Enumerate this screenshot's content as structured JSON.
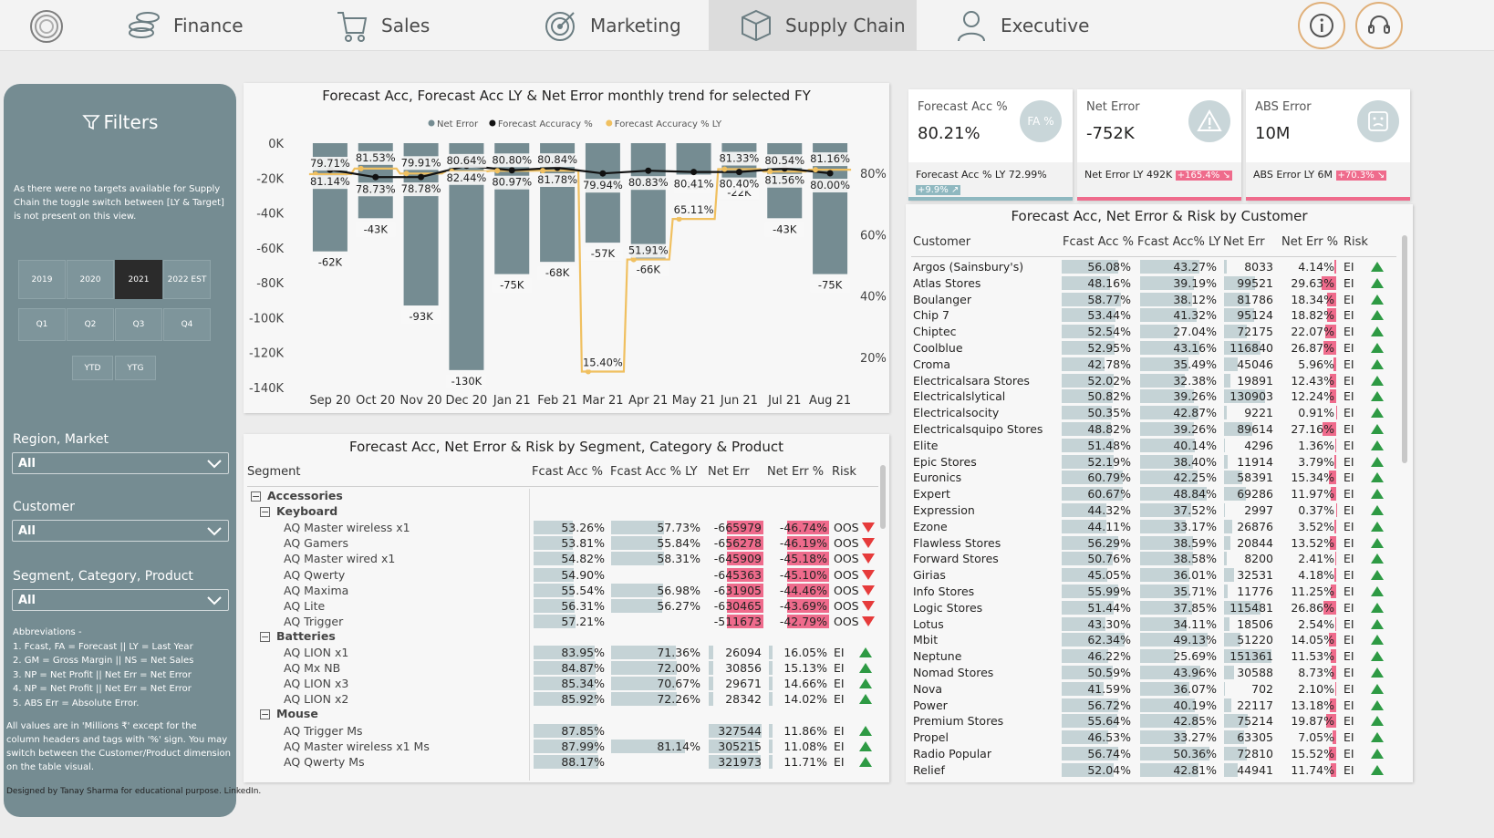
{
  "nav": {
    "tabs": [
      {
        "label": "Finance",
        "icon": "coins-icon"
      },
      {
        "label": "Sales",
        "icon": "cart-icon"
      },
      {
        "label": "Marketing",
        "icon": "target-icon"
      },
      {
        "label": "Supply Chain",
        "icon": "box-icon",
        "active": true
      },
      {
        "label": "Executive",
        "icon": "person-icon"
      }
    ],
    "info_icon": "info-icon",
    "support_icon": "headset-icon"
  },
  "filters": {
    "title": "Filters",
    "note": "As there were no targets available for Supply Chain the toggle switch between [LY & Target] is not present on this view.",
    "years": [
      "2019",
      "2020",
      "2021",
      "2022 EST"
    ],
    "selected_year": "2021",
    "quarters": [
      "Q1",
      "Q2",
      "Q3",
      "Q4"
    ],
    "periods": [
      "YTD",
      "YTG"
    ],
    "region_label": "Region, Market",
    "region_value": "All",
    "customer_label": "Customer",
    "customer_value": "All",
    "segment_label": "Segment, Category, Product",
    "segment_value": "All",
    "abbreviations": [
      "Abbreviations -",
      "1. Fcast, FA = Forecast || LY = Last Year",
      "2. GM = Gross Margin || NS = Net Sales",
      "3. NP = Net Profit || Net Err = Net Error",
      "4. NP = Net Profit || Net Err = Net Error",
      "5. ABS Err = Absolute Error."
    ],
    "values_note": "All values are in 'Millions ₹' except for the column headers and tags with '%' sign. You may switch between the Customer/Product dimension on the table visual."
  },
  "trend_chart": {
    "title": "Forecast Acc, Forecast Acc LY & Net Error monthly trend for selected FY",
    "legend": [
      {
        "label": "Net Error",
        "color": "#758c92"
      },
      {
        "label": "Forecast Accuracy %",
        "color": "#111111"
      },
      {
        "label": "Forecast Accuracy % LY",
        "color": "#f0c060"
      }
    ]
  },
  "chart_data": {
    "type": "bar",
    "categories": [
      "Sep 20",
      "Oct 20",
      "Nov 20",
      "Dec 20",
      "Jan 21",
      "Feb 21",
      "Mar 21",
      "Apr 21",
      "May 21",
      "Jun 21",
      "Jul 21",
      "Aug 21"
    ],
    "series": [
      {
        "name": "Net Error",
        "type": "bar",
        "axis": "left",
        "values": [
          -62,
          -43,
          -93,
          -130,
          -75,
          -68,
          -57,
          -66,
          -18,
          -22,
          -43,
          -75
        ],
        "labels": [
          "-62K",
          "-43K",
          "-93K",
          "-130K",
          "-75K",
          "-68K",
          "-57K",
          "-66K",
          "-18K",
          "-22K",
          "-43K",
          "-75K"
        ]
      },
      {
        "name": "Forecast Accuracy %",
        "type": "line",
        "axis": "right",
        "values": [
          81.14,
          78.73,
          78.78,
          82.44,
          80.97,
          81.78,
          79.94,
          80.83,
          80.41,
          80.4,
          81.56,
          80.0
        ]
      },
      {
        "name": "Forecast Accuracy % LY",
        "type": "line",
        "axis": "right",
        "values": [
          79.71,
          81.53,
          79.91,
          80.64,
          80.8,
          80.84,
          15.4,
          51.91,
          65.11,
          81.33,
          80.54,
          81.16
        ]
      }
    ],
    "left_axis": {
      "ticks": [
        "0K",
        "-20K",
        "-40K",
        "-60K",
        "-80K",
        "-100K",
        "-120K",
        "-140K"
      ],
      "ylim": [
        -140,
        0
      ]
    },
    "right_axis": {
      "ticks": [
        "80%",
        "60%",
        "40%",
        "20%"
      ]
    },
    "grid": false,
    "legend_position": "top-center"
  },
  "kpis": [
    {
      "label": "Forecast Acc %",
      "value": "80.21%",
      "icon": "fa-percent-icon",
      "icon_text": "FA %",
      "foot": "Forecast Acc % LY 72.99%",
      "chip": "+9.9% ↗",
      "chip_color": "#8fb8c0",
      "bar_color": "#8fb8c0"
    },
    {
      "label": "Net Error",
      "value": "-752K",
      "icon": "warning-icon",
      "foot": "Net Error LY 492K",
      "chip": "+165.4% ↘",
      "chip_color": "#ef6b8c",
      "bar_color": "#ef6b8c"
    },
    {
      "label": "ABS Error",
      "value": "10M",
      "icon": "sad-face-icon",
      "foot": "ABS Error LY 6M",
      "chip": "+70.3% ↘",
      "chip_color": "#ef6b8c",
      "bar_color": "#ef6b8c"
    }
  ],
  "segment_table": {
    "title": "Forecast Acc, Net Error & Risk by Segment, Category & Product",
    "headers": [
      "Segment",
      "Fcast Acc %",
      "Fcast Acc % LY",
      "Net Err",
      "Net Err %",
      "Risk"
    ],
    "rows": [
      {
        "kind": "segment",
        "name": "Accessories"
      },
      {
        "kind": "category",
        "name": "Keyboard"
      },
      {
        "kind": "product",
        "name": "AQ Master wireless x1",
        "fa": "53.26%",
        "fa_pct": 53.26,
        "faly": "57.73%",
        "faly_pct": 57.73,
        "ne": "-665979",
        "ne_prefix": "-6",
        "ne_rest": "65979",
        "nep": "-46.74%",
        "risk": "OOS",
        "dir": "down"
      },
      {
        "kind": "product",
        "name": "AQ Gamers",
        "fa": "53.81%",
        "fa_pct": 53.81,
        "faly": "55.84%",
        "faly_pct": 55.84,
        "ne": "-656278",
        "ne_prefix": "-6",
        "ne_rest": "56278",
        "nep": "-46.19%",
        "risk": "OOS",
        "dir": "down"
      },
      {
        "kind": "product",
        "name": "AQ Master wired x1",
        "fa": "54.82%",
        "fa_pct": 54.82,
        "faly": "58.31%",
        "faly_pct": 58.31,
        "ne": "-645909",
        "ne_prefix": "-6",
        "ne_rest": "45909",
        "nep": "-45.18%",
        "risk": "OOS",
        "dir": "down"
      },
      {
        "kind": "product",
        "name": "AQ Qwerty",
        "fa": "54.90%",
        "fa_pct": 54.9,
        "faly": "",
        "faly_pct": 0,
        "ne": "-645363",
        "ne_prefix": "-6",
        "ne_rest": "45363",
        "nep": "-45.10%",
        "risk": "OOS",
        "dir": "down"
      },
      {
        "kind": "product",
        "name": "AQ Maxima",
        "fa": "55.54%",
        "fa_pct": 55.54,
        "faly": "56.98%",
        "faly_pct": 56.98,
        "ne": "-631905",
        "ne_prefix": "-6",
        "ne_rest": "31905",
        "nep": "-44.46%",
        "risk": "OOS",
        "dir": "down"
      },
      {
        "kind": "product",
        "name": "AQ Lite",
        "fa": "56.31%",
        "fa_pct": 56.31,
        "faly": "56.27%",
        "faly_pct": 56.27,
        "ne": "-630465",
        "ne_prefix": "-6",
        "ne_rest": "30465",
        "nep": "-43.69%",
        "risk": "OOS",
        "dir": "down"
      },
      {
        "kind": "product",
        "name": "AQ Trigger",
        "fa": "57.21%",
        "fa_pct": 57.21,
        "faly": "",
        "faly_pct": 0,
        "ne": "-511673",
        "ne_prefix": "-5",
        "ne_rest": "11673",
        "nep": "-42.79%",
        "risk": "OOS",
        "dir": "down"
      },
      {
        "kind": "category",
        "name": "Batteries"
      },
      {
        "kind": "product",
        "name": "AQ LION x1",
        "fa": "83.95%",
        "fa_pct": 83.95,
        "faly": "71.36%",
        "faly_pct": 71.36,
        "ne": "26094",
        "ne_val": 26094,
        "nep": "16.05%",
        "risk": "EI",
        "dir": "up"
      },
      {
        "kind": "product",
        "name": "AQ Mx NB",
        "fa": "84.87%",
        "fa_pct": 84.87,
        "faly": "72.00%",
        "faly_pct": 72.0,
        "ne": "30856",
        "ne_val": 30856,
        "nep": "15.13%",
        "risk": "EI",
        "dir": "up"
      },
      {
        "kind": "product",
        "name": "AQ LION x3",
        "fa": "85.34%",
        "fa_pct": 85.34,
        "faly": "70.67%",
        "faly_pct": 70.67,
        "ne": "29671",
        "ne_val": 29671,
        "nep": "14.66%",
        "risk": "EI",
        "dir": "up"
      },
      {
        "kind": "product",
        "name": "AQ LION x2",
        "fa": "85.92%",
        "fa_pct": 85.92,
        "faly": "72.26%",
        "faly_pct": 72.26,
        "ne": "28342",
        "ne_val": 28342,
        "nep": "14.02%",
        "risk": "EI",
        "dir": "up"
      },
      {
        "kind": "category",
        "name": "Mouse"
      },
      {
        "kind": "product",
        "name": "AQ Trigger Ms",
        "fa": "87.85%",
        "fa_pct": 87.85,
        "faly": "",
        "faly_pct": 0,
        "ne": "327544",
        "ne_val": 327544,
        "nep": "11.86%",
        "risk": "EI",
        "dir": "up"
      },
      {
        "kind": "product",
        "name": "AQ Master wireless x1 Ms",
        "fa": "87.99%",
        "fa_pct": 87.99,
        "faly": "81.14%",
        "faly_pct": 81.14,
        "ne": "305215",
        "ne_val": 305215,
        "nep": "11.08%",
        "risk": "EI",
        "dir": "up"
      },
      {
        "kind": "product",
        "name": "AQ Qwerty Ms",
        "fa": "88.17%",
        "fa_pct": 88.17,
        "faly": "",
        "faly_pct": 0,
        "ne": "321973",
        "ne_val": 321973,
        "nep": "11.71%",
        "risk": "EI",
        "dir": "up"
      }
    ]
  },
  "customer_table": {
    "title": "Forecast Acc, Net Error & Risk by Customer",
    "headers": [
      "Customer",
      "Fcast Acc %",
      "Fcast Acc% LY",
      "Net Err",
      "Net Err %",
      "Risk"
    ],
    "rows": [
      {
        "name": "Argos (Sainsbury's)",
        "fa": "56.08%",
        "fa_pct": 56.08,
        "faly": "43.27%",
        "faly_pct": 43.27,
        "ne": "8033",
        "ne_val": 8033,
        "nep": "4.14%",
        "nep_val": 4.14,
        "risk": "EI"
      },
      {
        "name": "Atlas Stores",
        "fa": "48.16%",
        "fa_pct": 48.16,
        "faly": "39.19%",
        "faly_pct": 39.19,
        "ne": "99521",
        "ne_val": 99521,
        "nep": "29.63%",
        "nep_val": 29.63,
        "risk": "EI"
      },
      {
        "name": "Boulanger",
        "fa": "58.77%",
        "fa_pct": 58.77,
        "faly": "38.12%",
        "faly_pct": 38.12,
        "ne": "81786",
        "ne_val": 81786,
        "nep": "18.34%",
        "nep_val": 18.34,
        "risk": "EI"
      },
      {
        "name": "Chip 7",
        "fa": "53.44%",
        "fa_pct": 53.44,
        "faly": "41.32%",
        "faly_pct": 41.32,
        "ne": "95124",
        "ne_val": 95124,
        "nep": "18.82%",
        "nep_val": 18.82,
        "risk": "EI"
      },
      {
        "name": "Chiptec",
        "fa": "52.54%",
        "fa_pct": 52.54,
        "faly": "27.04%",
        "faly_pct": 27.04,
        "ne": "72175",
        "ne_val": 72175,
        "nep": "22.07%",
        "nep_val": 22.07,
        "risk": "EI"
      },
      {
        "name": "Coolblue",
        "fa": "52.95%",
        "fa_pct": 52.95,
        "faly": "43.16%",
        "faly_pct": 43.16,
        "ne": "116840",
        "ne_val": 116840,
        "nep": "26.87%",
        "nep_val": 26.87,
        "risk": "EI"
      },
      {
        "name": "Croma",
        "fa": "42.78%",
        "fa_pct": 42.78,
        "faly": "35.49%",
        "faly_pct": 35.49,
        "ne": "45046",
        "ne_val": 45046,
        "nep": "5.96%",
        "nep_val": 5.96,
        "risk": "EI"
      },
      {
        "name": "Electricalsara Stores",
        "fa": "52.02%",
        "fa_pct": 52.02,
        "faly": "32.38%",
        "faly_pct": 32.38,
        "ne": "19891",
        "ne_val": 19891,
        "nep": "12.43%",
        "nep_val": 12.43,
        "risk": "EI"
      },
      {
        "name": "Electricalslytical",
        "fa": "50.82%",
        "fa_pct": 50.82,
        "faly": "39.26%",
        "faly_pct": 39.26,
        "ne": "130903",
        "ne_val": 130903,
        "nep": "12.24%",
        "nep_val": 12.24,
        "risk": "EI"
      },
      {
        "name": "Electricalsocity",
        "fa": "50.35%",
        "fa_pct": 50.35,
        "faly": "42.87%",
        "faly_pct": 42.87,
        "ne": "9221",
        "ne_val": 9221,
        "nep": "0.91%",
        "nep_val": 0.91,
        "risk": "EI"
      },
      {
        "name": "Electricalsquipo Stores",
        "fa": "48.82%",
        "fa_pct": 48.82,
        "faly": "39.26%",
        "faly_pct": 39.26,
        "ne": "89614",
        "ne_val": 89614,
        "nep": "27.16%",
        "nep_val": 27.16,
        "risk": "EI"
      },
      {
        "name": "Elite",
        "fa": "51.48%",
        "fa_pct": 51.48,
        "faly": "40.14%",
        "faly_pct": 40.14,
        "ne": "4296",
        "ne_val": 4296,
        "nep": "1.36%",
        "nep_val": 1.36,
        "risk": "EI"
      },
      {
        "name": "Epic Stores",
        "fa": "52.19%",
        "fa_pct": 52.19,
        "faly": "38.40%",
        "faly_pct": 38.4,
        "ne": "11914",
        "ne_val": 11914,
        "nep": "3.79%",
        "nep_val": 3.79,
        "risk": "EI"
      },
      {
        "name": "Euronics",
        "fa": "60.79%",
        "fa_pct": 60.79,
        "faly": "42.25%",
        "faly_pct": 42.25,
        "ne": "58391",
        "ne_val": 58391,
        "nep": "15.34%",
        "nep_val": 15.34,
        "risk": "EI"
      },
      {
        "name": "Expert",
        "fa": "60.67%",
        "fa_pct": 60.67,
        "faly": "48.84%",
        "faly_pct": 48.84,
        "ne": "69286",
        "ne_val": 69286,
        "nep": "11.97%",
        "nep_val": 11.97,
        "risk": "EI"
      },
      {
        "name": "Expression",
        "fa": "44.32%",
        "fa_pct": 44.32,
        "faly": "37.52%",
        "faly_pct": 37.52,
        "ne": "2997",
        "ne_val": 2997,
        "nep": "0.37%",
        "nep_val": 0.37,
        "risk": "EI"
      },
      {
        "name": "Ezone",
        "fa": "44.11%",
        "fa_pct": 44.11,
        "faly": "33.17%",
        "faly_pct": 33.17,
        "ne": "26876",
        "ne_val": 26876,
        "nep": "3.52%",
        "nep_val": 3.52,
        "risk": "EI"
      },
      {
        "name": "Flawless Stores",
        "fa": "56.29%",
        "fa_pct": 56.29,
        "faly": "38.59%",
        "faly_pct": 38.59,
        "ne": "20844",
        "ne_val": 20844,
        "nep": "13.52%",
        "nep_val": 13.52,
        "risk": "EI"
      },
      {
        "name": "Forward Stores",
        "fa": "50.76%",
        "fa_pct": 50.76,
        "faly": "38.58%",
        "faly_pct": 38.58,
        "ne": "8200",
        "ne_val": 8200,
        "nep": "2.41%",
        "nep_val": 2.41,
        "risk": "EI"
      },
      {
        "name": "Girias",
        "fa": "45.05%",
        "fa_pct": 45.05,
        "faly": "36.01%",
        "faly_pct": 36.01,
        "ne": "32531",
        "ne_val": 32531,
        "nep": "4.18%",
        "nep_val": 4.18,
        "risk": "EI"
      },
      {
        "name": "Info Stores",
        "fa": "55.99%",
        "fa_pct": 55.99,
        "faly": "35.71%",
        "faly_pct": 35.71,
        "ne": "11776",
        "ne_val": 11776,
        "nep": "11.25%",
        "nep_val": 11.25,
        "risk": "EI"
      },
      {
        "name": "Logic Stores",
        "fa": "51.44%",
        "fa_pct": 51.44,
        "faly": "37.85%",
        "faly_pct": 37.85,
        "ne": "115481",
        "ne_val": 115481,
        "nep": "26.86%",
        "nep_val": 26.86,
        "risk": "EI"
      },
      {
        "name": "Lotus",
        "fa": "43.30%",
        "fa_pct": 43.3,
        "faly": "34.11%",
        "faly_pct": 34.11,
        "ne": "18506",
        "ne_val": 18506,
        "nep": "2.54%",
        "nep_val": 2.54,
        "risk": "EI"
      },
      {
        "name": "Mbit",
        "fa": "62.34%",
        "fa_pct": 62.34,
        "faly": "49.13%",
        "faly_pct": 49.13,
        "ne": "51220",
        "ne_val": 51220,
        "nep": "14.05%",
        "nep_val": 14.05,
        "risk": "EI"
      },
      {
        "name": "Neptune",
        "fa": "46.22%",
        "fa_pct": 46.22,
        "faly": "25.69%",
        "faly_pct": 25.69,
        "ne": "151361",
        "ne_val": 151361,
        "nep": "11.53%",
        "nep_val": 11.53,
        "risk": "EI"
      },
      {
        "name": "Nomad Stores",
        "fa": "50.59%",
        "fa_pct": 50.59,
        "faly": "43.96%",
        "faly_pct": 43.96,
        "ne": "30588",
        "ne_val": 30588,
        "nep": "8.73%",
        "nep_val": 8.73,
        "risk": "EI"
      },
      {
        "name": "Nova",
        "fa": "41.59%",
        "fa_pct": 41.59,
        "faly": "36.07%",
        "faly_pct": 36.07,
        "ne": "702",
        "ne_val": 702,
        "nep": "2.10%",
        "nep_val": 2.1,
        "risk": "EI"
      },
      {
        "name": "Power",
        "fa": "56.72%",
        "fa_pct": 56.72,
        "faly": "40.19%",
        "faly_pct": 40.19,
        "ne": "22117",
        "ne_val": 22117,
        "nep": "13.18%",
        "nep_val": 13.18,
        "risk": "EI"
      },
      {
        "name": "Premium Stores",
        "fa": "55.64%",
        "fa_pct": 55.64,
        "faly": "42.85%",
        "faly_pct": 42.85,
        "ne": "75214",
        "ne_val": 75214,
        "nep": "19.87%",
        "nep_val": 19.87,
        "risk": "EI"
      },
      {
        "name": "Propel",
        "fa": "46.53%",
        "fa_pct": 46.53,
        "faly": "33.27%",
        "faly_pct": 33.27,
        "ne": "63305",
        "ne_val": 63305,
        "nep": "7.05%",
        "nep_val": 7.05,
        "risk": "EI"
      },
      {
        "name": "Radio Popular",
        "fa": "56.74%",
        "fa_pct": 56.74,
        "faly": "50.36%",
        "faly_pct": 50.36,
        "ne": "72810",
        "ne_val": 72810,
        "nep": "15.52%",
        "nep_val": 15.52,
        "risk": "EI"
      },
      {
        "name": "Relief",
        "fa": "52.04%",
        "fa_pct": 52.04,
        "faly": "42.81%",
        "faly_pct": 42.81,
        "ne": "44941",
        "ne_val": 44941,
        "nep": "11.74%",
        "nep_val": 11.74,
        "risk": "EI"
      }
    ]
  },
  "credit": "Designed by Tanay Sharma for educational purpose. LinkedIn."
}
